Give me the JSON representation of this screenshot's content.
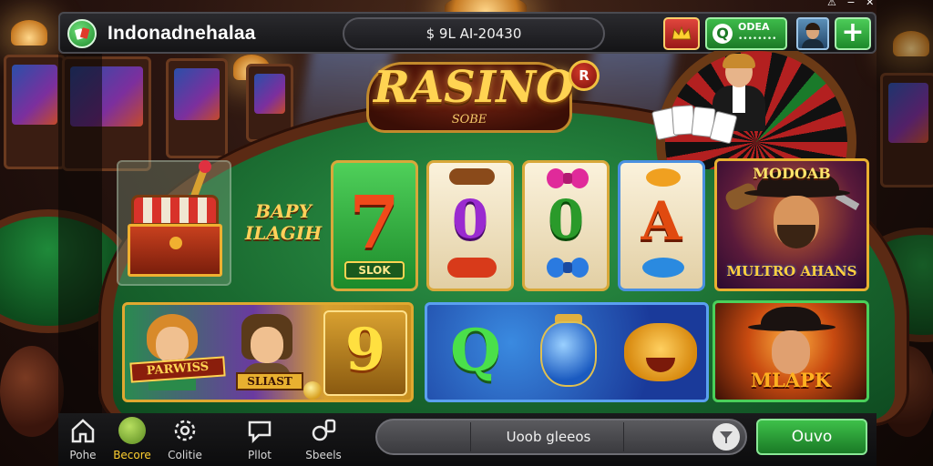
{
  "header": {
    "app_title": "Indonadnehalaa",
    "balance": "$ 9L AI-20430",
    "bonus_line1": "ODEA",
    "bonus_line2": "••••••••",
    "add_symbol": "+",
    "system_icons": "⚠ − ✕"
  },
  "logo": {
    "title": "RASINO",
    "subtitle": "SOBE",
    "badge": "R"
  },
  "promo": {
    "line1": "BAPY",
    "line2": "ILAGIH"
  },
  "reels": [
    {
      "symbol": "7",
      "label": "SLOK",
      "color": "#f04a1a"
    },
    {
      "symbol": "0",
      "color": "#9a2ad0"
    },
    {
      "symbol": "0",
      "color": "#2a9a2a"
    },
    {
      "symbol": "A",
      "color": "#e04a10"
    }
  ],
  "featured": {
    "title": "MODOAB",
    "subtitle": "MULTRO AHANS"
  },
  "tiles": {
    "a_banner1": "PARWISS",
    "a_banner2": "SLIAST",
    "a_number": "9",
    "b_letter": "Q",
    "c_title": "MLAPK"
  },
  "nav": {
    "items": [
      {
        "label": "Pohe",
        "icon": "home-icon"
      },
      {
        "label": "Becore",
        "icon": "coin-icon",
        "active": true
      },
      {
        "label": "Colitie",
        "icon": "settings-icon"
      },
      {
        "label": "Pllot",
        "icon": "chat-icon"
      },
      {
        "label": "Sbeels",
        "icon": "games-icon"
      }
    ],
    "search_text": "Uoob gleeos",
    "play_label": "Ouvo"
  },
  "colors": {
    "accent_green": "#2fa83c",
    "gold": "#ffd452",
    "felt": "#1a6a30"
  }
}
